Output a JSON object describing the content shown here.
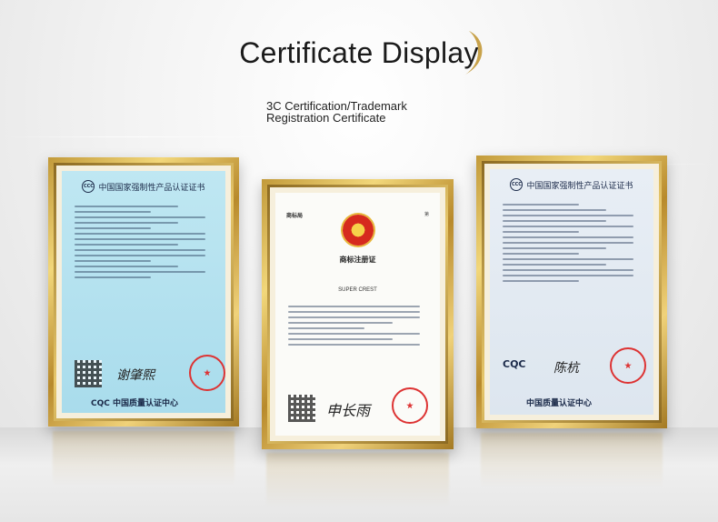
{
  "header": {
    "title": "Certificate Display",
    "subtitle_line1": "3C Certification/Trademark",
    "subtitle_line2": "Registration Certificate"
  },
  "certificates": [
    {
      "heading": "中国国家强制性产品认证证书",
      "footer": "中国质量认证中心",
      "badge": "CQC"
    },
    {
      "heading": "商标注册证",
      "mark": "SUPER CREST",
      "stamp": "商标局"
    },
    {
      "heading": "中国国家强制性产品认证证书",
      "footer": "中国质量认证中心",
      "badge": "CQC"
    }
  ],
  "colors": {
    "frame_gold": "#c29a3a",
    "cert_blue": "#a9dcec",
    "seal_red": "#d33333"
  }
}
